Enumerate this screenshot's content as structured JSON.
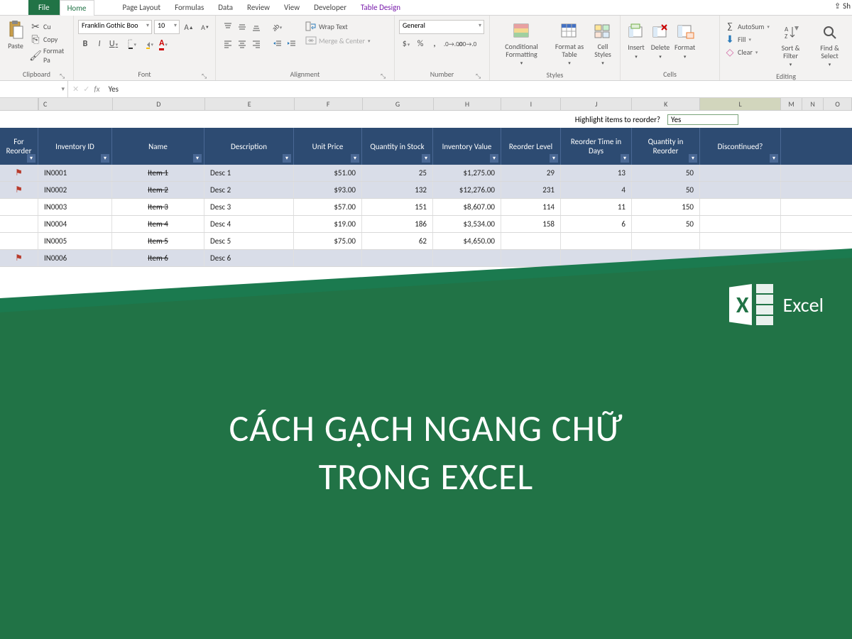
{
  "tabs": {
    "file": "File",
    "home": "Home",
    "pageLayout": "Page Layout",
    "formulas": "Formulas",
    "data": "Data",
    "review": "Review",
    "view": "View",
    "developer": "Developer",
    "tableDesign": "Table Design",
    "share": "Sh"
  },
  "ribbon": {
    "clipboard": {
      "title": "Clipboard",
      "paste": "Paste",
      "cut": "Cu",
      "copy": "Copy",
      "formatPainter": "Format Pa"
    },
    "font": {
      "title": "Font",
      "family": "Franklin Gothic Boo",
      "size": "10",
      "bold": "B",
      "italic": "I",
      "underline": "U"
    },
    "alignment": {
      "title": "Alignment",
      "wrap": "Wrap Text",
      "merge": "Merge & Center"
    },
    "number": {
      "title": "Number",
      "format": "General"
    },
    "styles": {
      "title": "Styles",
      "cf": "Conditional Formatting",
      "fat": "Format as Table",
      "cs": "Cell Styles"
    },
    "cells": {
      "title": "Cells",
      "insert": "Insert",
      "delete": "Delete",
      "format": "Format"
    },
    "editing": {
      "title": "Editing",
      "autosum": "AutoSum",
      "fill": "Fill",
      "clear": "Clear",
      "sort": "Sort & Filter",
      "find": "Find & Select"
    }
  },
  "formulaBar": {
    "fx": "fx",
    "value": "Yes"
  },
  "cols": {
    "c": "C",
    "d": "D",
    "e": "E",
    "f": "F",
    "g": "G",
    "h": "H",
    "i": "I",
    "j": "J",
    "k": "K",
    "l": "L",
    "m": "M",
    "n": "N",
    "o": "O"
  },
  "info": {
    "label": "Highlight items to reorder?",
    "value": "Yes"
  },
  "headers": {
    "flag": "For Reorder",
    "inv": "Inventory ID",
    "name": "Name",
    "desc": "Description",
    "price": "Unit Price",
    "qty": "Quantity in Stock",
    "invval": "Inventory Value",
    "rlvl": "Reorder Level",
    "rdays": "Reorder Time in Days",
    "rqty": "Quantity in Reorder",
    "disc": "Discontinued?"
  },
  "rows": [
    {
      "flag": true,
      "hl": true,
      "inv": "IN0001",
      "name": "Item 1",
      "desc": "Desc 1",
      "price": "$51.00",
      "qty": "25",
      "invval": "$1,275.00",
      "rlvl": "29",
      "rdays": "13",
      "rqty": "50"
    },
    {
      "flag": true,
      "hl": true,
      "inv": "IN0002",
      "name": "Item 2",
      "desc": "Desc 2",
      "price": "$93.00",
      "qty": "132",
      "invval": "$12,276.00",
      "rlvl": "231",
      "rdays": "4",
      "rqty": "50"
    },
    {
      "flag": false,
      "hl": false,
      "inv": "IN0003",
      "name": "Item 3",
      "desc": "Desc 3",
      "price": "$57.00",
      "qty": "151",
      "invval": "$8,607.00",
      "rlvl": "114",
      "rdays": "11",
      "rqty": "150"
    },
    {
      "flag": false,
      "hl": false,
      "inv": "IN0004",
      "name": "Item 4",
      "desc": "Desc 4",
      "price": "$19.00",
      "qty": "186",
      "invval": "$3,534.00",
      "rlvl": "158",
      "rdays": "6",
      "rqty": "50"
    },
    {
      "flag": false,
      "hl": false,
      "inv": "IN0005",
      "name": "Item 5",
      "desc": "Desc 5",
      "price": "$75.00",
      "qty": "62",
      "invval": "$4,650.00",
      "rlvl": "",
      "rdays": "",
      "rqty": ""
    },
    {
      "flag": true,
      "hl": true,
      "inv": "IN0006",
      "name": "Item 6",
      "desc": "Desc 6",
      "price": "",
      "qty": "",
      "invval": "",
      "rlvl": "",
      "rdays": "",
      "rqty": ""
    }
  ],
  "overlay": {
    "excel": "Excel",
    "headline1": "CÁCH GẠCH NGANG CHỮ",
    "headline2": "TRONG EXCEL"
  }
}
